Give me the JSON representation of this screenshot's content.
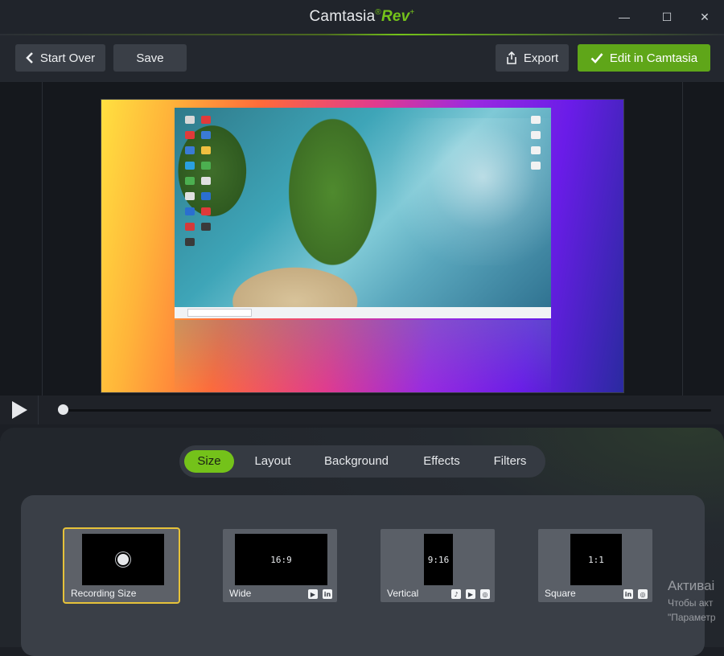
{
  "window": {
    "brand_main": "Camtasia",
    "brand_suffix": "Rev",
    "brand_plus": "+",
    "minimize": "—",
    "maximize": "☐",
    "close": "✕"
  },
  "toolbar": {
    "start_over": "Start Over",
    "save": "Save",
    "export": "Export",
    "edit_in_camtasia": "Edit in Camtasia"
  },
  "player": {
    "progress": 0.0
  },
  "tabs": [
    {
      "label": "Size",
      "active": true
    },
    {
      "label": "Layout",
      "active": false
    },
    {
      "label": "Background",
      "active": false
    },
    {
      "label": "Effects",
      "active": false
    },
    {
      "label": "Filters",
      "active": false
    }
  ],
  "sizes": [
    {
      "label": "Recording Size",
      "thumb_text": "",
      "selected": true,
      "badges": []
    },
    {
      "label": "Wide",
      "thumb_text": "16:9",
      "selected": false,
      "badges": [
        "youtube-icon",
        "linkedin-icon"
      ]
    },
    {
      "label": "Vertical",
      "thumb_text": "9:16",
      "selected": false,
      "badges": [
        "tiktok-icon",
        "youtube-icon",
        "instagram-icon"
      ]
    },
    {
      "label": "Square",
      "thumb_text": "1:1",
      "selected": false,
      "badges": [
        "linkedin-icon",
        "instagram-icon"
      ]
    }
  ],
  "watermark": {
    "line1": "Активаі",
    "line2": "Чтобы акт",
    "line3": "\"Параметр"
  },
  "colors": {
    "accent": "#74c21a",
    "selected_border": "#e6c23a"
  }
}
